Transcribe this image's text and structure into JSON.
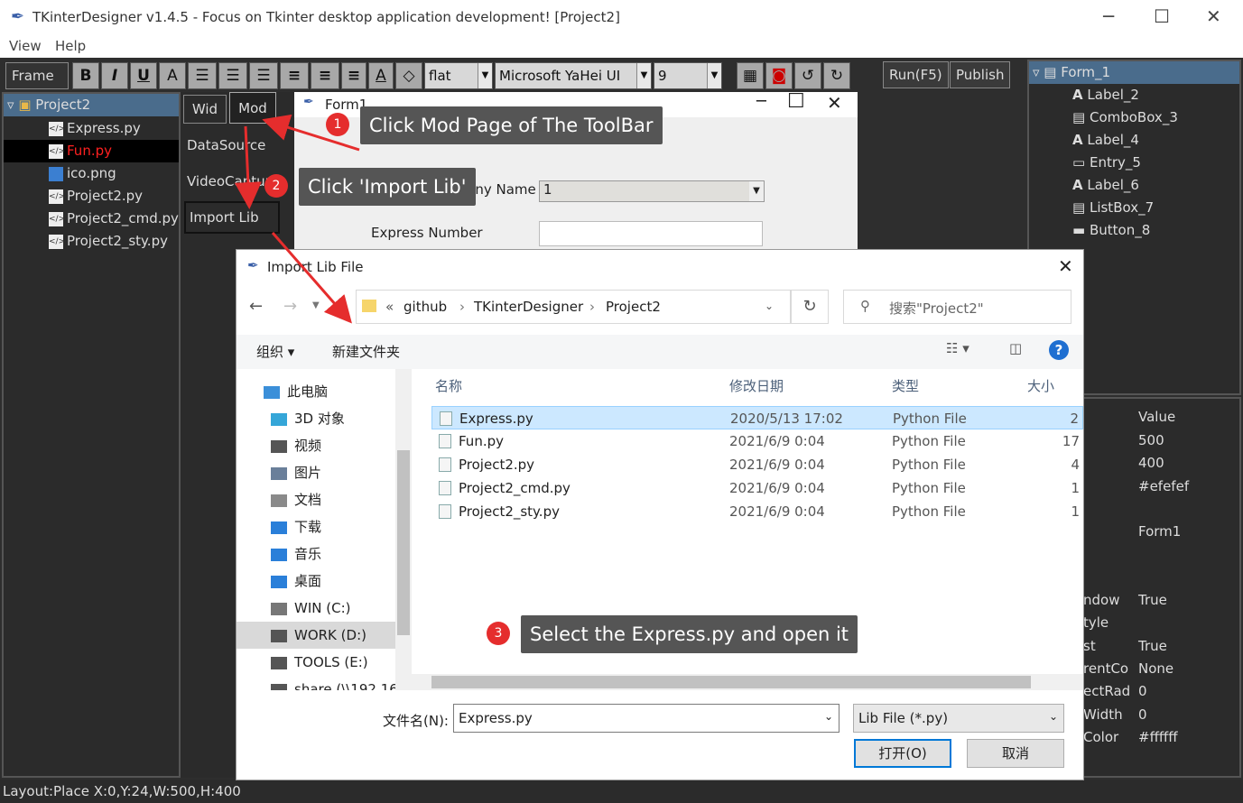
{
  "window": {
    "title": "TKinterDesigner v1.4.5 - Focus on Tkinter desktop application development!    [Project2]",
    "minimize": "─",
    "maximize": "☐",
    "close": "✕"
  },
  "menu": [
    "View",
    "Help"
  ],
  "toolbar": {
    "frame": "Frame",
    "bold": "B",
    "italic": "I",
    "underline": "U",
    "font_a": "A",
    "relief": "flat",
    "font": "Microsoft YaHei UI",
    "size": "9",
    "run": "Run(F5)",
    "publish": "Publish"
  },
  "project_tree": {
    "root": "Project2",
    "items": [
      {
        "name": "Express.py"
      },
      {
        "name": "Fun.py",
        "selected": true
      },
      {
        "name": "ico.png"
      },
      {
        "name": "Project2.py"
      },
      {
        "name": "Project2_cmd.py"
      },
      {
        "name": "Project2_sty.py"
      }
    ]
  },
  "mod_panel": {
    "tabs": [
      "Wid",
      "Mod"
    ],
    "items": [
      "DataSource",
      "VideoCapture",
      "Import Lib"
    ]
  },
  "form": {
    "title": "Form1",
    "label1": "Express Company Name",
    "combo_value": "1",
    "label2": "Express Number"
  },
  "widget_tree": {
    "root": "Form_1",
    "items": [
      "Label_2",
      "ComboBox_3",
      "Label_4",
      "Entry_5",
      "Label_6",
      "ListBox_7",
      "Button_8"
    ]
  },
  "properties": {
    "header": "Value",
    "rows": [
      {
        "name": "",
        "value": "500"
      },
      {
        "name": "",
        "value": "400"
      },
      {
        "name": "",
        "value": "#efefef"
      },
      {
        "name": "",
        "value": ""
      },
      {
        "name": "",
        "value": "Form1"
      },
      {
        "name": "",
        "value": ""
      },
      {
        "name": "",
        "value": ""
      },
      {
        "name": "ndow",
        "value": "True"
      },
      {
        "name": "tyle",
        "value": ""
      },
      {
        "name": "st",
        "value": "True"
      },
      {
        "name": "rentCo",
        "value": "None"
      },
      {
        "name": "ectRad",
        "value": "0"
      },
      {
        "name": "Width",
        "value": "0"
      },
      {
        "name": "Color",
        "value": "#ffffff"
      }
    ]
  },
  "status": "Layout:Place   X:0,Y:24,W:500,H:400",
  "dialog": {
    "title": "Import Lib File",
    "breadcrumb": [
      "«",
      "github",
      "TKinterDesigner",
      "Project2"
    ],
    "search_placeholder": "搜索\"Project2\"",
    "organize": "组织 ▾",
    "new_folder": "新建文件夹",
    "sidebar": [
      "此电脑",
      "3D 对象",
      "视频",
      "图片",
      "文档",
      "下载",
      "音乐",
      "桌面",
      "WIN (C:)",
      "WORK (D:)",
      "TOOLS (E:)",
      "share (\\\\192.16"
    ],
    "columns": [
      "名称",
      "修改日期",
      "类型",
      "大小"
    ],
    "files": [
      {
        "name": "Express.py",
        "date": "2020/5/13 17:02",
        "type": "Python File",
        "size": "2"
      },
      {
        "name": "Fun.py",
        "date": "2021/6/9 0:04",
        "type": "Python File",
        "size": "17"
      },
      {
        "name": "Project2.py",
        "date": "2021/6/9 0:04",
        "type": "Python File",
        "size": "4"
      },
      {
        "name": "Project2_cmd.py",
        "date": "2021/6/9 0:04",
        "type": "Python File",
        "size": "1"
      },
      {
        "name": "Project2_sty.py",
        "date": "2021/6/9 0:04",
        "type": "Python File",
        "size": "1"
      }
    ],
    "filename_label": "文件名(N):",
    "filename": "Express.py",
    "filter": "Lib File (*.py)",
    "open": "打开(O)",
    "cancel": "取消"
  },
  "annotations": [
    {
      "n": "1",
      "text": "Click Mod Page of The ToolBar"
    },
    {
      "n": "2",
      "text": "Click 'Import Lib'"
    },
    {
      "n": "3",
      "text": "Select the Express.py and open it"
    }
  ],
  "colors": {
    "annotation_red": "#e52d2d",
    "selected_blue": "#cce8ff",
    "tree_header": "#4a6c8c"
  }
}
